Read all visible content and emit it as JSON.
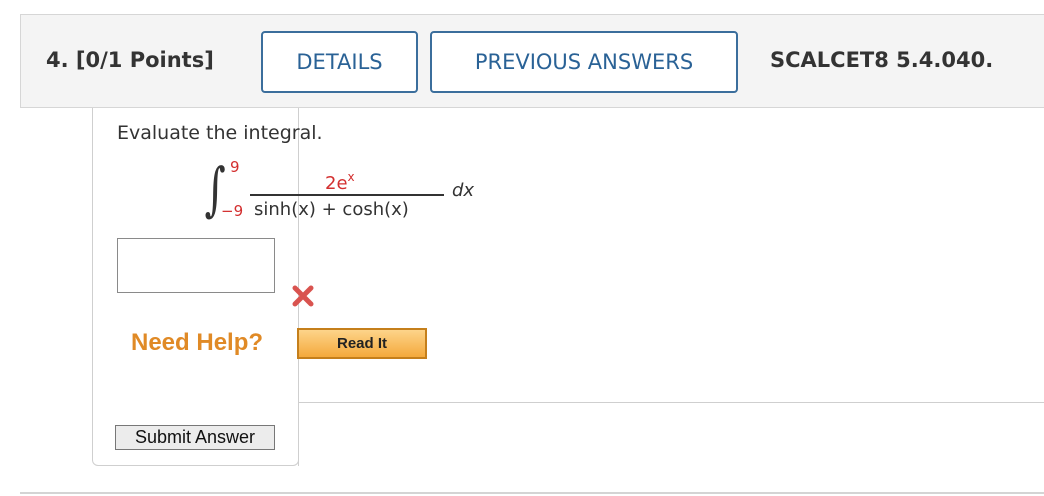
{
  "header": {
    "question_label": "4. [0/1 Points]",
    "details_label": "DETAILS",
    "previous_answers_label": "PREVIOUS ANSWERS",
    "course_code": "SCALCET8 5.4.040."
  },
  "question": {
    "prompt": "Evaluate the integral.",
    "integral": {
      "upper_limit": "9",
      "lower_limit": "−9",
      "numerator_base": "2e",
      "numerator_exponent": "x",
      "denominator": "sinh(x) + cosh(x)",
      "differential": "dx"
    }
  },
  "answer": {
    "value": "",
    "status_icon": "wrong-x-icon"
  },
  "help": {
    "need_help_label": "Need Help?",
    "read_it_label": "Read It"
  },
  "actions": {
    "submit_label": "Submit Answer"
  },
  "colors": {
    "accent_blue": "#2a6296",
    "error_red": "#d32f2f",
    "help_orange": "#e08a26"
  }
}
